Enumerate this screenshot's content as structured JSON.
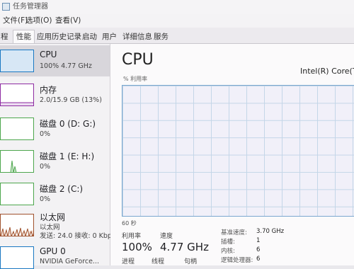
{
  "window": {
    "title": "任务管理器"
  },
  "menu": {
    "file": "文件(F)",
    "options": "选项(O)",
    "view": "查看(V)"
  },
  "tabs": [
    {
      "label": "程"
    },
    {
      "label": "性能"
    },
    {
      "label": "应用历史记录"
    },
    {
      "label": "启动"
    },
    {
      "label": "用户"
    },
    {
      "label": "详细信息"
    },
    {
      "label": "服务"
    }
  ],
  "sidebar": {
    "items": [
      {
        "name": "CPU",
        "sub1": "100% 4.77 GHz",
        "color": "#1a78c2"
      },
      {
        "name": "内存",
        "sub1": "2.0/15.9 GB (13%)",
        "color": "#8e2ca2"
      },
      {
        "name": "磁盘 0 (D: G:)",
        "sub1": "0%",
        "color": "#4da64d"
      },
      {
        "name": "磁盘 1 (E: H:)",
        "sub1": "0%",
        "color": "#4da64d"
      },
      {
        "name": "磁盘 2 (C:)",
        "sub1": "0%",
        "color": "#4da64d"
      },
      {
        "name": "以太网",
        "sub1": "以太网",
        "sub2": "发送: 24.0 接收: 0 Kbp",
        "color": "#a0522d"
      },
      {
        "name": "GPU 0",
        "sub1": "NVIDIA GeForce...",
        "color": "#1a78c2"
      }
    ]
  },
  "main": {
    "title": "CPU",
    "model": "Intel(R) Core(TM",
    "y_axis_label": "% 利用率",
    "time_label": "60 秒",
    "utilization_label": "利用率",
    "utilization_value": "100%",
    "speed_label": "速度",
    "speed_value": "4.77 GHz",
    "process_label": "进程",
    "thread_label": "线程",
    "handle_label": "句柄",
    "specs": [
      {
        "label": "基准速度:",
        "value": "3.70 GHz"
      },
      {
        "label": "插槽:",
        "value": "1"
      },
      {
        "label": "内核:",
        "value": "6"
      },
      {
        "label": "逻辑处理器:",
        "value": "6"
      }
    ]
  }
}
